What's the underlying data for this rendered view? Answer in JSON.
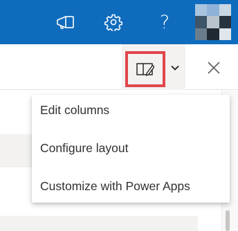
{
  "suite_header": {
    "background": "#0f6cbd",
    "buttons": [
      {
        "icon": "megaphone-icon"
      },
      {
        "icon": "gear-icon"
      },
      {
        "icon": "question-mark-icon",
        "glyph": "?"
      }
    ]
  },
  "command_bar": {
    "view_button": {
      "icon": "edit-view-icon",
      "highlight_color": "#e0464b"
    },
    "view_dropdown": {
      "icon": "chevron-down-icon"
    },
    "close_button": {
      "icon": "close-icon"
    }
  },
  "view_menu": {
    "items": [
      {
        "label": "Edit columns"
      },
      {
        "label": "Configure layout"
      },
      {
        "label": "Customize with Power Apps"
      }
    ]
  }
}
